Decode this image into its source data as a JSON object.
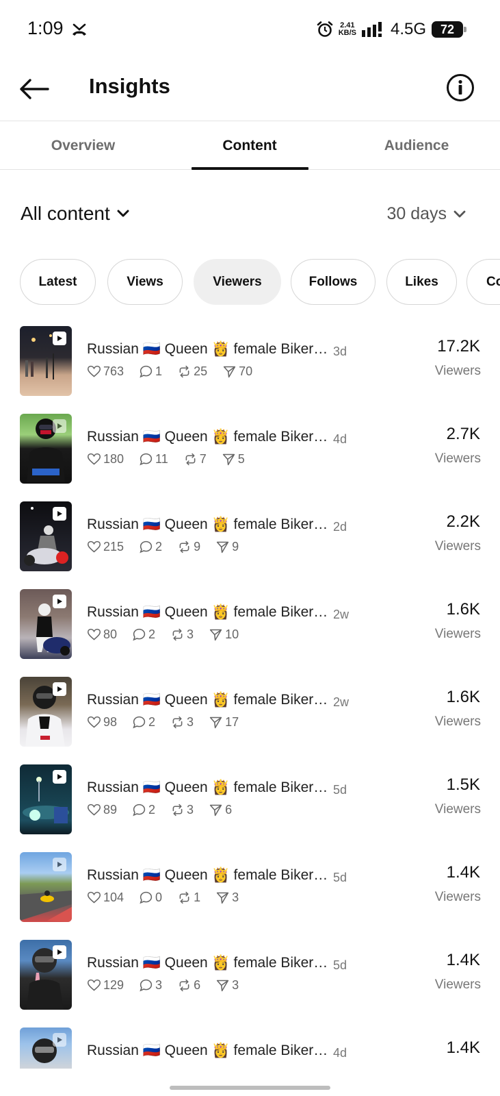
{
  "status_bar": {
    "time": "1:09",
    "speed_top": "2.41",
    "speed_bottom": "KB/S",
    "network": "4.5G",
    "battery": "72",
    "battery_level": 0.72
  },
  "header": {
    "title": "Insights",
    "back_icon": "arrow-left-icon",
    "info_icon": "info-icon"
  },
  "tabs": [
    {
      "label": "Overview",
      "active": false
    },
    {
      "label": "Content",
      "active": true
    },
    {
      "label": "Audience",
      "active": false
    }
  ],
  "filters": {
    "content_label": "All content",
    "period_label": "30 days"
  },
  "chips": [
    {
      "label": "Latest",
      "selected": false
    },
    {
      "label": "Views",
      "selected": false
    },
    {
      "label": "Viewers",
      "selected": true
    },
    {
      "label": "Follows",
      "selected": false
    },
    {
      "label": "Likes",
      "selected": false
    },
    {
      "label": "Co",
      "selected": false
    }
  ],
  "posts": [
    {
      "title": "Russian 🇷🇺 Queen 👸 female Biker…",
      "age": "3d",
      "likes": "763",
      "comments": "1",
      "reposts": "25",
      "shares": "70",
      "value": "17.2K",
      "unit": "Viewers"
    },
    {
      "title": "Russian 🇷🇺 Queen 👸 female Biker…",
      "age": "4d",
      "likes": "180",
      "comments": "11",
      "reposts": "7",
      "shares": "5",
      "value": "2.7K",
      "unit": "Viewers"
    },
    {
      "title": "Russian 🇷🇺 Queen 👸 female Biker…",
      "age": "2d",
      "likes": "215",
      "comments": "2",
      "reposts": "9",
      "shares": "9",
      "value": "2.2K",
      "unit": "Viewers"
    },
    {
      "title": "Russian 🇷🇺 Queen 👸 female Biker…",
      "age": "2w",
      "likes": "80",
      "comments": "2",
      "reposts": "3",
      "shares": "10",
      "value": "1.6K",
      "unit": "Viewers"
    },
    {
      "title": "Russian 🇷🇺 Queen 👸 female Biker…",
      "age": "2w",
      "likes": "98",
      "comments": "2",
      "reposts": "3",
      "shares": "17",
      "value": "1.6K",
      "unit": "Viewers"
    },
    {
      "title": "Russian 🇷🇺 Queen 👸 female Biker…",
      "age": "5d",
      "likes": "89",
      "comments": "2",
      "reposts": "3",
      "shares": "6",
      "value": "1.5K",
      "unit": "Viewers"
    },
    {
      "title": "Russian 🇷🇺 Queen 👸 female Biker…",
      "age": "5d",
      "likes": "104",
      "comments": "0",
      "reposts": "1",
      "shares": "3",
      "value": "1.4K",
      "unit": "Viewers"
    },
    {
      "title": "Russian 🇷🇺 Queen 👸 female Biker…",
      "age": "5d",
      "likes": "129",
      "comments": "3",
      "reposts": "6",
      "shares": "3",
      "value": "1.4K",
      "unit": "Viewers"
    },
    {
      "title": "Russian 🇷🇺 Queen 👸 female Biker…",
      "age": "4d",
      "value": "1.4K"
    }
  ]
}
